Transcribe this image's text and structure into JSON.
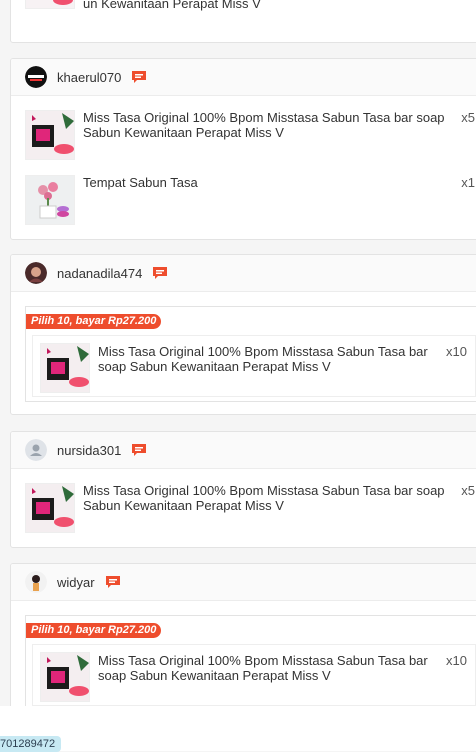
{
  "orders": [
    {
      "username": "khaerul070",
      "items": [
        {
          "name": "Miss Tasa Original 100% Bpom Misstasa Sabun Tasa bar soap Sabun Kewanitaan Perapat Miss V",
          "qty": "x5"
        },
        {
          "name": "Tempat Sabun Tasa",
          "qty": "x1"
        }
      ]
    },
    {
      "username": "nadanadila474",
      "bundle_label": "Pilih 10, bayar Rp27.200",
      "items": [
        {
          "name": "Miss Tasa Original 100% Bpom Misstasa Sabun Tasa bar soap Sabun Kewanitaan Perapat Miss V",
          "qty": "x10"
        }
      ]
    },
    {
      "username": "nursida301",
      "items": [
        {
          "name": "Miss Tasa Original 100% Bpom Misstasa Sabun Tasa bar soap Sabun Kewanitaan Perapat Miss V",
          "qty": "x5"
        }
      ]
    },
    {
      "username": "widyar",
      "bundle_label": "Pilih 10, bayar Rp27.200",
      "items": [
        {
          "name": "Miss Tasa Original 100% Bpom Misstasa Sabun Tasa bar soap Sabun Kewanitaan Perapat Miss V",
          "qty": "x10"
        }
      ]
    }
  ],
  "top_partial": {
    "name": "un Kewanitaan Perapat Miss V"
  },
  "order_id_fragment": "701289472",
  "colors": {
    "accent": "#ee4d2d",
    "tag_bg": "#c7e9f3"
  },
  "icons": {
    "chat": "chat-bubble-icon",
    "default_avatar": "user-icon"
  }
}
